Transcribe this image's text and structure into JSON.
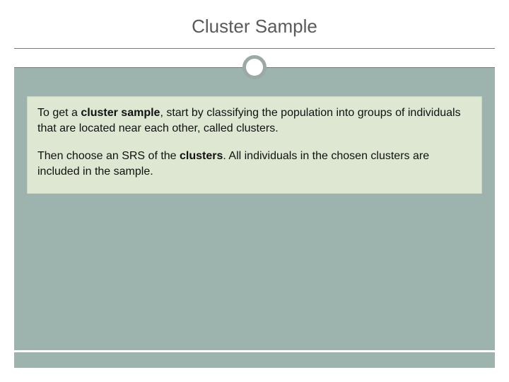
{
  "slide": {
    "title": "Cluster Sample",
    "para1": {
      "lead": "To get a ",
      "bold": "cluster sample",
      "rest": ", start by classifying the population into groups of individuals that are located near each other, called clusters."
    },
    "para2": {
      "lead": "Then choose an SRS of the ",
      "bold": "clusters",
      "rest": ". All individuals in the chosen clusters are included in the sample."
    }
  }
}
